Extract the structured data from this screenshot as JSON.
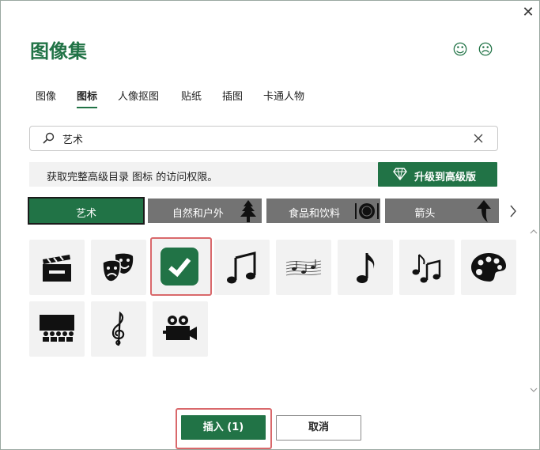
{
  "dialog": {
    "title": "图像集",
    "close_icon": "close-icon",
    "feedback": {
      "happy": "smile-icon",
      "sad": "frown-icon"
    }
  },
  "tabs": [
    {
      "label": "图像",
      "active": false
    },
    {
      "label": "图标",
      "active": true
    },
    {
      "label": "人像抠图",
      "active": false
    },
    {
      "label": "贴纸",
      "active": false
    },
    {
      "label": "插图",
      "active": false
    },
    {
      "label": "卡通人物",
      "active": false
    }
  ],
  "search": {
    "value": "艺术",
    "icon": "search-icon",
    "clear_icon": "close-icon"
  },
  "banner": {
    "text": "获取完整高级目录 图标 的访问权限。",
    "upgrade_label": "升级到高级版",
    "upgrade_icon": "diamond-icon"
  },
  "categories": [
    {
      "label": "艺术",
      "active": true
    },
    {
      "label": "自然和户外",
      "icon": "tree-icon"
    },
    {
      "label": "食品和饮料",
      "icon": "plate-icon"
    },
    {
      "label": "箭头",
      "icon": "arrow-icon"
    }
  ],
  "icons": [
    {
      "name": "clapperboard-icon",
      "selected": false
    },
    {
      "name": "theater-masks-icon",
      "selected": false
    },
    {
      "name": "easel-icon",
      "selected": true
    },
    {
      "name": "music-notes-icon",
      "selected": false
    },
    {
      "name": "sheet-music-icon",
      "selected": false
    },
    {
      "name": "eighth-note-icon",
      "selected": false
    },
    {
      "name": "music-notes-small-icon",
      "selected": false
    },
    {
      "name": "palette-icon",
      "selected": false
    },
    {
      "name": "theater-audience-icon",
      "selected": false
    },
    {
      "name": "treble-clef-icon",
      "selected": false
    },
    {
      "name": "movie-camera-icon",
      "selected": false
    }
  ],
  "footer": {
    "insert_label": "插入 (1)",
    "cancel_label": "取消"
  },
  "colors": {
    "accent": "#217346",
    "selection": "#d9686b",
    "chip": "#737373"
  }
}
